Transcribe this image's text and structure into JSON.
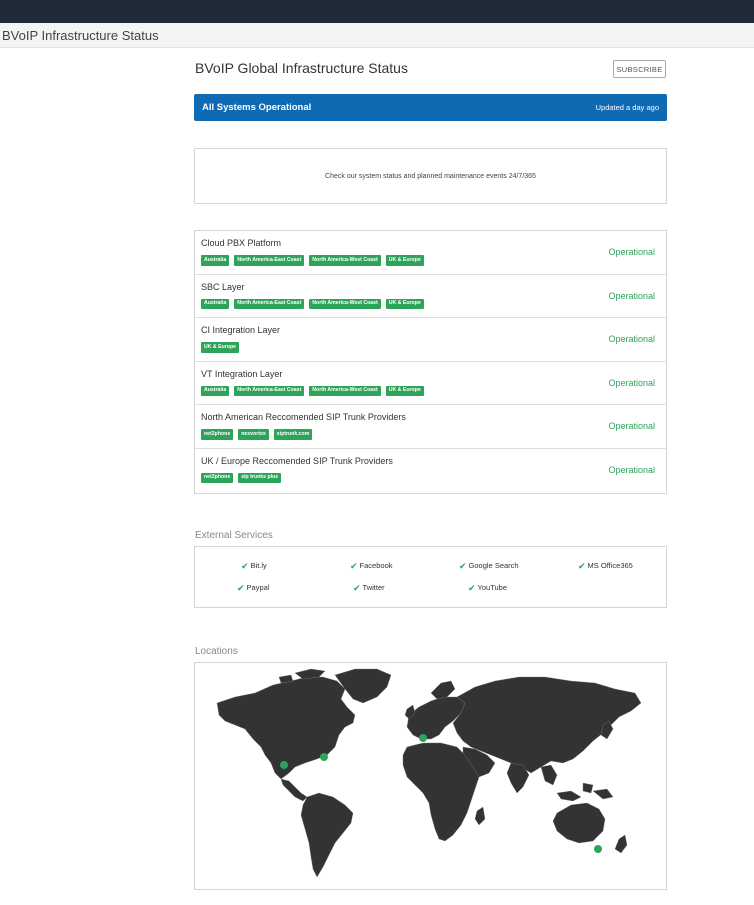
{
  "app": {
    "title": "BVoIP Infrastructure Status"
  },
  "header": {
    "page_title": "BVoIP Global Infrastructure Status",
    "subscribe_label": "SUBSCRIBE"
  },
  "banner": {
    "status": "All Systems Operational",
    "updated": "Updated a day ago",
    "color": "#0f6ab4"
  },
  "message": "Check our system status and planned maintenance events 24/7/365",
  "components": [
    {
      "name": "Cloud PBX Platform",
      "tags": [
        "Australia",
        "North America-East Coast",
        "North America-West Coast",
        "UK & Europe"
      ],
      "status": "Operational"
    },
    {
      "name": "SBC Layer",
      "tags": [
        "Australia",
        "North America-East Coast",
        "North America-West Coast",
        "UK & Europe"
      ],
      "status": "Operational"
    },
    {
      "name": "CI Integration Layer",
      "tags": [
        "UK & Europe"
      ],
      "status": "Operational"
    },
    {
      "name": "VT Integration Layer",
      "tags": [
        "Australia",
        "North America-East Coast",
        "North America-West Coast",
        "UK & Europe"
      ],
      "status": "Operational"
    },
    {
      "name": "North American Reccomended SIP Trunk Providers",
      "tags": [
        "net2phone",
        "nexvortex",
        "siptrunk.com"
      ],
      "status": "Operational"
    },
    {
      "name": "UK / Europe Reccomended SIP Trunk Providers",
      "tags": [
        "net2phone",
        "sip trunks plus"
      ],
      "status": "Operational"
    }
  ],
  "external_services": {
    "title": "External Services",
    "items": [
      "Bit.ly",
      "Facebook",
      "Google Search",
      "MS Office365",
      "Paypal",
      "Twitter",
      "YouTube"
    ]
  },
  "locations": {
    "title": "Locations",
    "markers": [
      "North America-West Coast",
      "North America-East Coast",
      "UK & Europe",
      "Australia"
    ],
    "map_color": "#333333",
    "marker_color": "#2ea45a"
  },
  "colors": {
    "operational": "#2ea45a",
    "topbar": "#202b38"
  }
}
